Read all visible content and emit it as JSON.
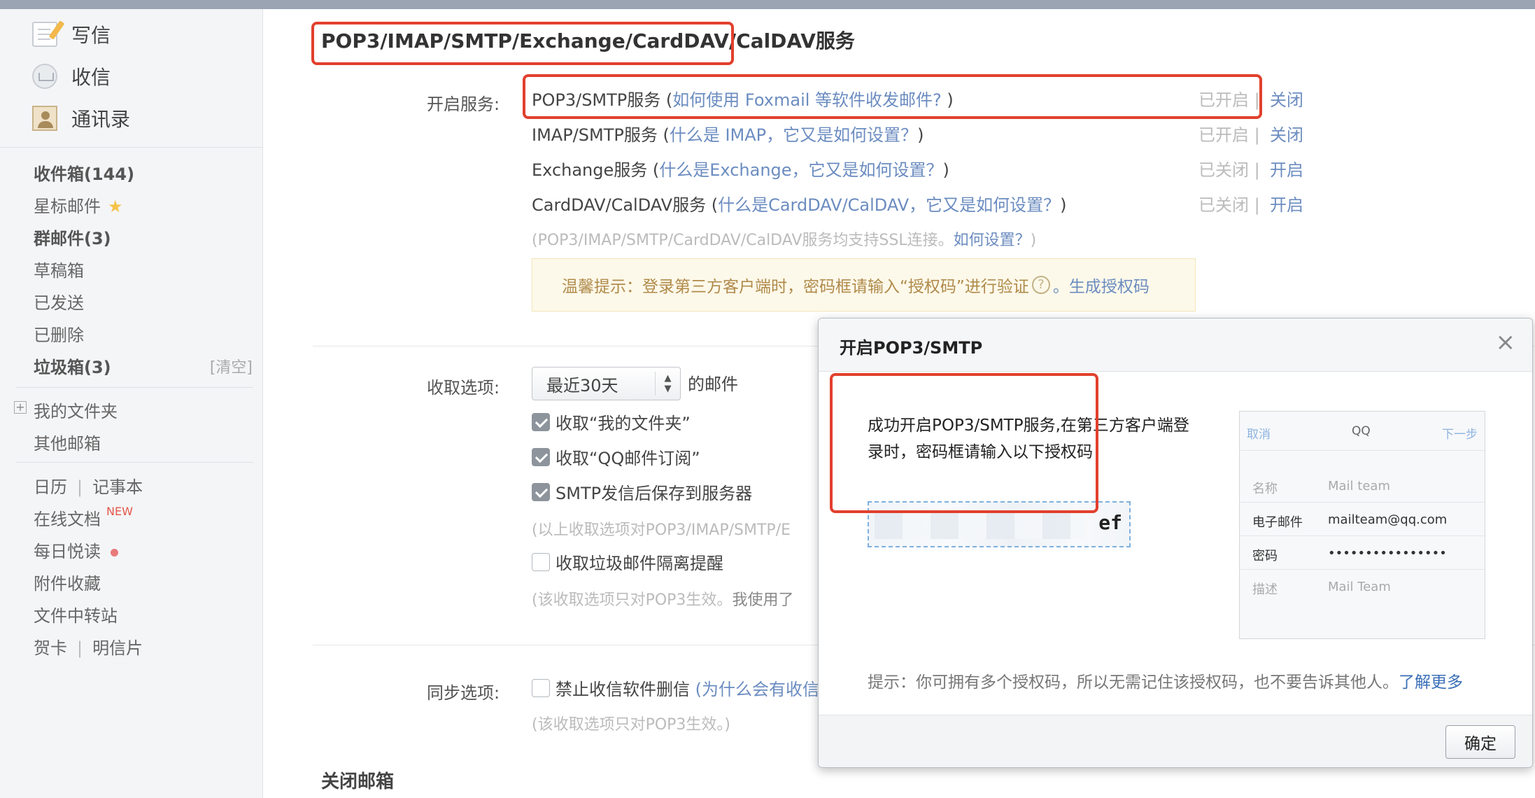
{
  "sidebar": {
    "write_label": "写信",
    "receive_label": "收信",
    "contacts_label": "通讯录",
    "inbox": "收件箱(144)",
    "starred": "星标邮件",
    "group_mail": "群邮件(3)",
    "drafts": "草稿箱",
    "sent": "已发送",
    "deleted": "已删除",
    "spam": "垃圾箱(3)",
    "spam_clear": "[清空]",
    "my_folders": "我的文件夹",
    "other_mailboxes": "其他邮箱",
    "calendar": "日历",
    "notebook": "记事本",
    "online_docs": "在线文档",
    "online_docs_badge": "NEW",
    "daily_reading": "每日悦读",
    "attachments": "附件收藏",
    "file_transfer": "文件中转站",
    "greeting_card": "贺卡",
    "postcard": "明信片",
    "separator": "|"
  },
  "main": {
    "title": "POP3/IMAP/SMTP/Exchange/CardDAV/CalDAV服务",
    "enable_label": "开启服务:",
    "services": [
      {
        "name": "POP3/SMTP服务 (",
        "link": "如何使用 Foxmail 等软件收发邮件?",
        "close": " )",
        "state": "已开启 |",
        "action": "关闭"
      },
      {
        "name": "IMAP/SMTP服务 (",
        "link": "什么是 IMAP，它又是如何设置？",
        "close": ")",
        "state": "已开启 |",
        "action": "关闭"
      },
      {
        "name": "Exchange服务 (",
        "link": "什么是Exchange，它又是如何设置？",
        "close": ")",
        "state": "已关闭 |",
        "action": "开启"
      },
      {
        "name": "CardDAV/CalDAV服务 (",
        "link": "什么是CardDAV/CalDAV，它又是如何设置？",
        "close": ")",
        "state": "已关闭 |",
        "action": "开启"
      }
    ],
    "ssl_note": "(POP3/IMAP/SMTP/CardDAV/CalDAV服务均支持SSL连接。",
    "ssl_link": "如何设置？",
    "ssl_close": ")",
    "tip_text": "温馨提示：登录第三方客户端时，密码框请输入“授权码”进行验证",
    "tip_q": "?",
    "tip_link": "。生成授权码",
    "receive_label": "收取选项:",
    "receive_period": "最近30天",
    "receive_suffix": "的邮件",
    "opt_my_folders": "收取“我的文件夹”",
    "opt_qq_subscription": "收取“QQ邮件订阅”",
    "opt_smtp_save": "SMTP发信后保存到服务器",
    "opt_note1": "(以上收取选项对POP3/IMAP/SMTP/E",
    "opt_spam_alert": "收取垃圾邮件隔离提醒",
    "opt_note2": "(该收取选项只对POP3生效。",
    "opt_note2_dark": "我使用了",
    "sync_label": "同步选项:",
    "sync_opt": "禁止收信软件删信",
    "sync_link": "(为什么会有收信",
    "sync_note": "(该收取选项只对POP3生效。)",
    "close_mailbox": "关闭邮箱"
  },
  "dialog": {
    "title": "开启POP3/SMTP",
    "close_glyph": "×",
    "message": "成功开启POP3/SMTP服务,在第三方客户端登录时，密码框请输入以下授权码：",
    "code_tail": "ef",
    "phone": {
      "cancel": "取消",
      "title": "QQ",
      "next": "下一步",
      "rows": [
        {
          "key": "名称",
          "value": "Mail team",
          "dim": true
        },
        {
          "key": "电子邮件",
          "value": "mailteam@qq.com",
          "dim": false
        },
        {
          "key": "密码",
          "value": "••••••••••••••••",
          "dim": false
        },
        {
          "key": "描述",
          "value": "Mail Team",
          "dim": true
        }
      ]
    },
    "hint": "提示：你可拥有多个授权码，所以无需记住该授权码，也不要告诉其他人。",
    "hint_link": "了解更多",
    "ok_label": "确定"
  },
  "colors": {
    "highlight": "#e2402d",
    "link": "#6b8cc0",
    "sidebar_bg": "#f4f5f7"
  }
}
